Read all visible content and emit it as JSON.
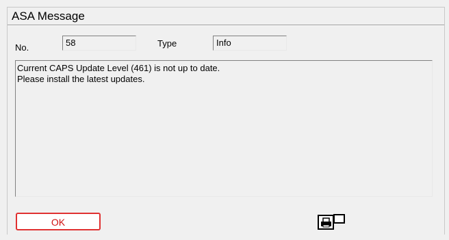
{
  "window": {
    "title": "ASA Message"
  },
  "fields": {
    "number_label": "No.",
    "number_value": "58",
    "type_label": "Type",
    "type_value": "Info"
  },
  "message": {
    "lines": [
      "Current CAPS Update Level (461) is not up to date.",
      "Please install the latest updates."
    ]
  },
  "buttons": {
    "ok_label": "OK",
    "print_icon": "print-preview-icon"
  },
  "colors": {
    "ok_border": "#e03030",
    "ok_text": "#d01010",
    "background": "#f0f0f0"
  }
}
